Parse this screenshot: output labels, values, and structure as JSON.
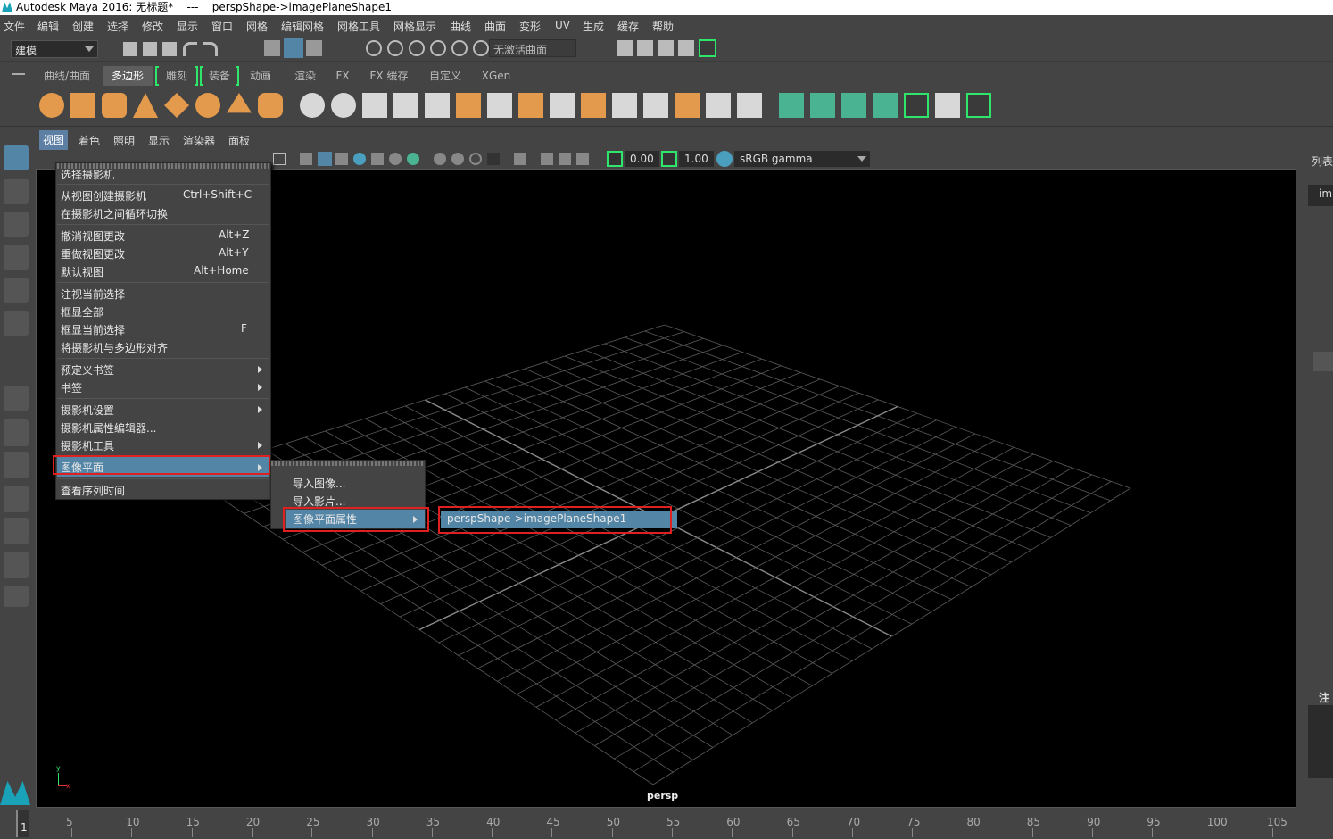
{
  "window": {
    "title": "Autodesk Maya 2016: 无标题*    ---    perspShape->imagePlaneShape1"
  },
  "menubar": [
    "文件",
    "编辑",
    "创建",
    "选择",
    "修改",
    "显示",
    "窗口",
    "网格",
    "编辑网格",
    "网格工具",
    "网格显示",
    "曲线",
    "曲面",
    "变形",
    "UV",
    "生成",
    "缓存",
    "帮助"
  ],
  "status": {
    "mode": "建模",
    "live_surface": "无激活曲面"
  },
  "shelf_tabs": [
    "曲线/曲面",
    "多边形",
    "雕刻",
    "装备",
    "动画",
    "渲染",
    "FX",
    "FX 缓存",
    "自定义",
    "XGen"
  ],
  "panel_menu": [
    "视图",
    "着色",
    "照明",
    "显示",
    "渲染器",
    "面板"
  ],
  "panel_toolbar": {
    "exposure": "0.00",
    "gamma": "1.00",
    "colorspace": "sRGB gamma"
  },
  "viewport": {
    "camera": "persp"
  },
  "right_panel": {
    "label1": "列表",
    "label2": "im",
    "label3": "注释"
  },
  "view_menu": {
    "items": [
      {
        "label": "选择摄影机",
        "shortcut": ""
      },
      {
        "label": "从视图创建摄影机",
        "shortcut": "Ctrl+Shift+C"
      },
      {
        "label": "在摄影机之间循环切换",
        "shortcut": ""
      },
      {
        "label": "撤消视图更改",
        "shortcut": "Alt+Z"
      },
      {
        "label": "重做视图更改",
        "shortcut": "Alt+Y"
      },
      {
        "label": "默认视图",
        "shortcut": "Alt+Home"
      },
      {
        "label": "注视当前选择",
        "shortcut": ""
      },
      {
        "label": "框显全部",
        "shortcut": ""
      },
      {
        "label": "框显当前选择",
        "shortcut": "F"
      },
      {
        "label": "将摄影机与多边形对齐",
        "shortcut": ""
      },
      {
        "label": "预定义书签",
        "shortcut": ""
      },
      {
        "label": "书签",
        "shortcut": ""
      },
      {
        "label": "摄影机设置",
        "shortcut": ""
      },
      {
        "label": "摄影机属性编辑器...",
        "shortcut": ""
      },
      {
        "label": "摄影机工具",
        "shortcut": ""
      },
      {
        "label": "图像平面",
        "shortcut": ""
      },
      {
        "label": "查看序列时间",
        "shortcut": ""
      }
    ]
  },
  "image_plane_submenu": [
    "导入图像...",
    "导入影片...",
    "图像平面属性"
  ],
  "image_plane_attr_submenu": [
    "perspShape->imagePlaneShape1"
  ],
  "timeline": {
    "current": "1",
    "ticks": [
      "5",
      "10",
      "15",
      "20",
      "25",
      "30",
      "35",
      "40",
      "45",
      "50",
      "55",
      "60",
      "65",
      "70",
      "75",
      "80",
      "85",
      "90",
      "95",
      "100",
      "105"
    ]
  }
}
